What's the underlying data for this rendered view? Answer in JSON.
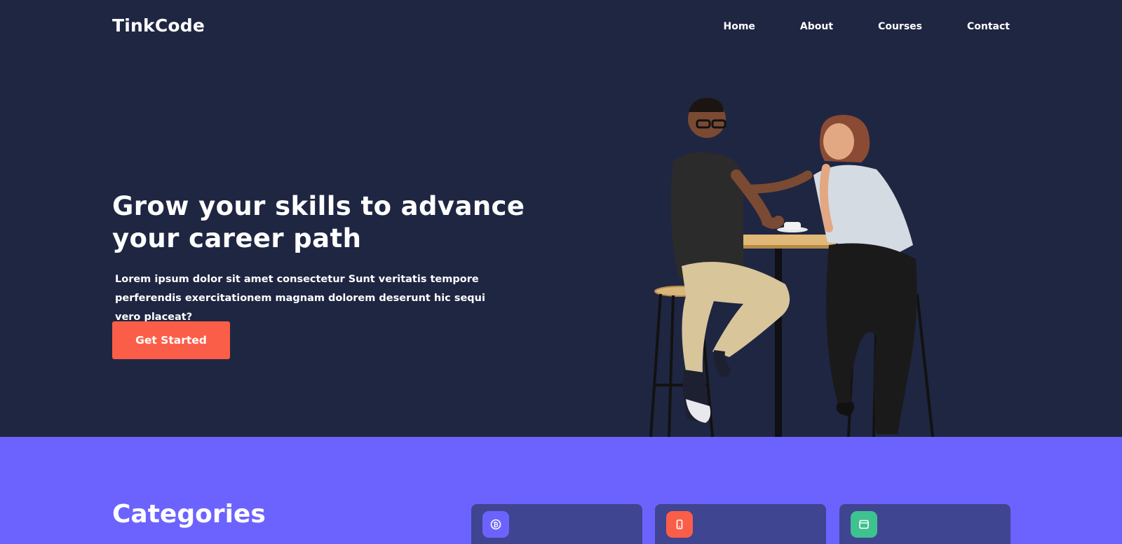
{
  "brand": "TinkCode",
  "nav": {
    "items": [
      {
        "label": "Home"
      },
      {
        "label": "About"
      },
      {
        "label": "Courses"
      },
      {
        "label": "Contact"
      }
    ]
  },
  "hero": {
    "headline": "Grow your skills to advance your career path",
    "subtext": "Lorem ipsum dolor sit amet consectetur Sunt veritatis tempore perferendis exercitationem magnam dolorem deserunt hic sequi vero placeat?",
    "cta_label": "Get Started"
  },
  "categories": {
    "title": "Categories",
    "cards": [
      {
        "icon": "bitcoin-icon",
        "color": "#6c63ff"
      },
      {
        "icon": "mobile-icon",
        "color": "#fb5e48"
      },
      {
        "icon": "browser-window-icon",
        "color": "#3ec28f"
      }
    ]
  },
  "colors": {
    "hero_bg": "#1f2642",
    "accent": "#fb5e48",
    "categories_bg": "#6c63ff",
    "card_bg": "#3f4590"
  }
}
